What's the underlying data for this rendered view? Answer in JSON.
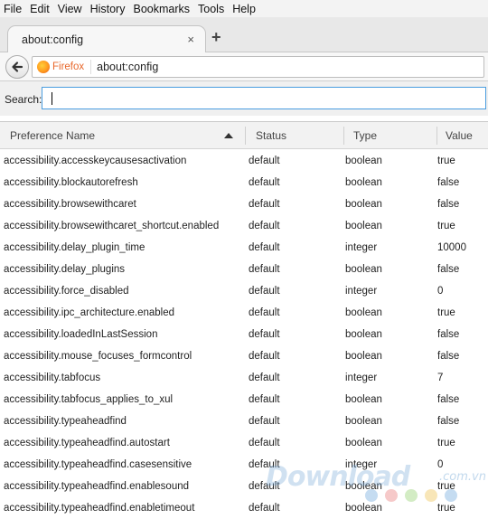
{
  "menubar": {
    "items": [
      "File",
      "Edit",
      "View",
      "History",
      "Bookmarks",
      "Tools",
      "Help"
    ]
  },
  "tab": {
    "title": "about:config",
    "close_glyph": "×"
  },
  "newtab": {
    "glyph": "+"
  },
  "navbar": {
    "identity": "Firefox",
    "url": "about:config"
  },
  "search": {
    "label": "Search:",
    "value": ""
  },
  "columns": [
    "Preference Name",
    "Status",
    "Type",
    "Value"
  ],
  "rows": [
    [
      "accessibility.accesskeycausesactivation",
      "default",
      "boolean",
      "true"
    ],
    [
      "accessibility.blockautorefresh",
      "default",
      "boolean",
      "false"
    ],
    [
      "accessibility.browsewithcaret",
      "default",
      "boolean",
      "false"
    ],
    [
      "accessibility.browsewithcaret_shortcut.enabled",
      "default",
      "boolean",
      "true"
    ],
    [
      "accessibility.delay_plugin_time",
      "default",
      "integer",
      "10000"
    ],
    [
      "accessibility.delay_plugins",
      "default",
      "boolean",
      "false"
    ],
    [
      "accessibility.force_disabled",
      "default",
      "integer",
      "0"
    ],
    [
      "accessibility.ipc_architecture.enabled",
      "default",
      "boolean",
      "true"
    ],
    [
      "accessibility.loadedInLastSession",
      "default",
      "boolean",
      "false"
    ],
    [
      "accessibility.mouse_focuses_formcontrol",
      "default",
      "boolean",
      "false"
    ],
    [
      "accessibility.tabfocus",
      "default",
      "integer",
      "7"
    ],
    [
      "accessibility.tabfocus_applies_to_xul",
      "default",
      "boolean",
      "false"
    ],
    [
      "accessibility.typeaheadfind",
      "default",
      "boolean",
      "false"
    ],
    [
      "accessibility.typeaheadfind.autostart",
      "default",
      "boolean",
      "true"
    ],
    [
      "accessibility.typeaheadfind.casesensitive",
      "default",
      "integer",
      "0"
    ],
    [
      "accessibility.typeaheadfind.enablesound",
      "default",
      "boolean",
      "true"
    ],
    [
      "accessibility.typeaheadfind.enabletimeout",
      "default",
      "boolean",
      "true"
    ]
  ],
  "watermark": {
    "text": "Download",
    "suffix": ".com.vn",
    "dot_colors": [
      "#c5dcf1",
      "#f6c9c9",
      "#d3ecc4",
      "#f8e6b8",
      "#c5dcf1"
    ]
  },
  "colors": {
    "focus_border": "#4a9de0",
    "identity": "#e8672b"
  }
}
